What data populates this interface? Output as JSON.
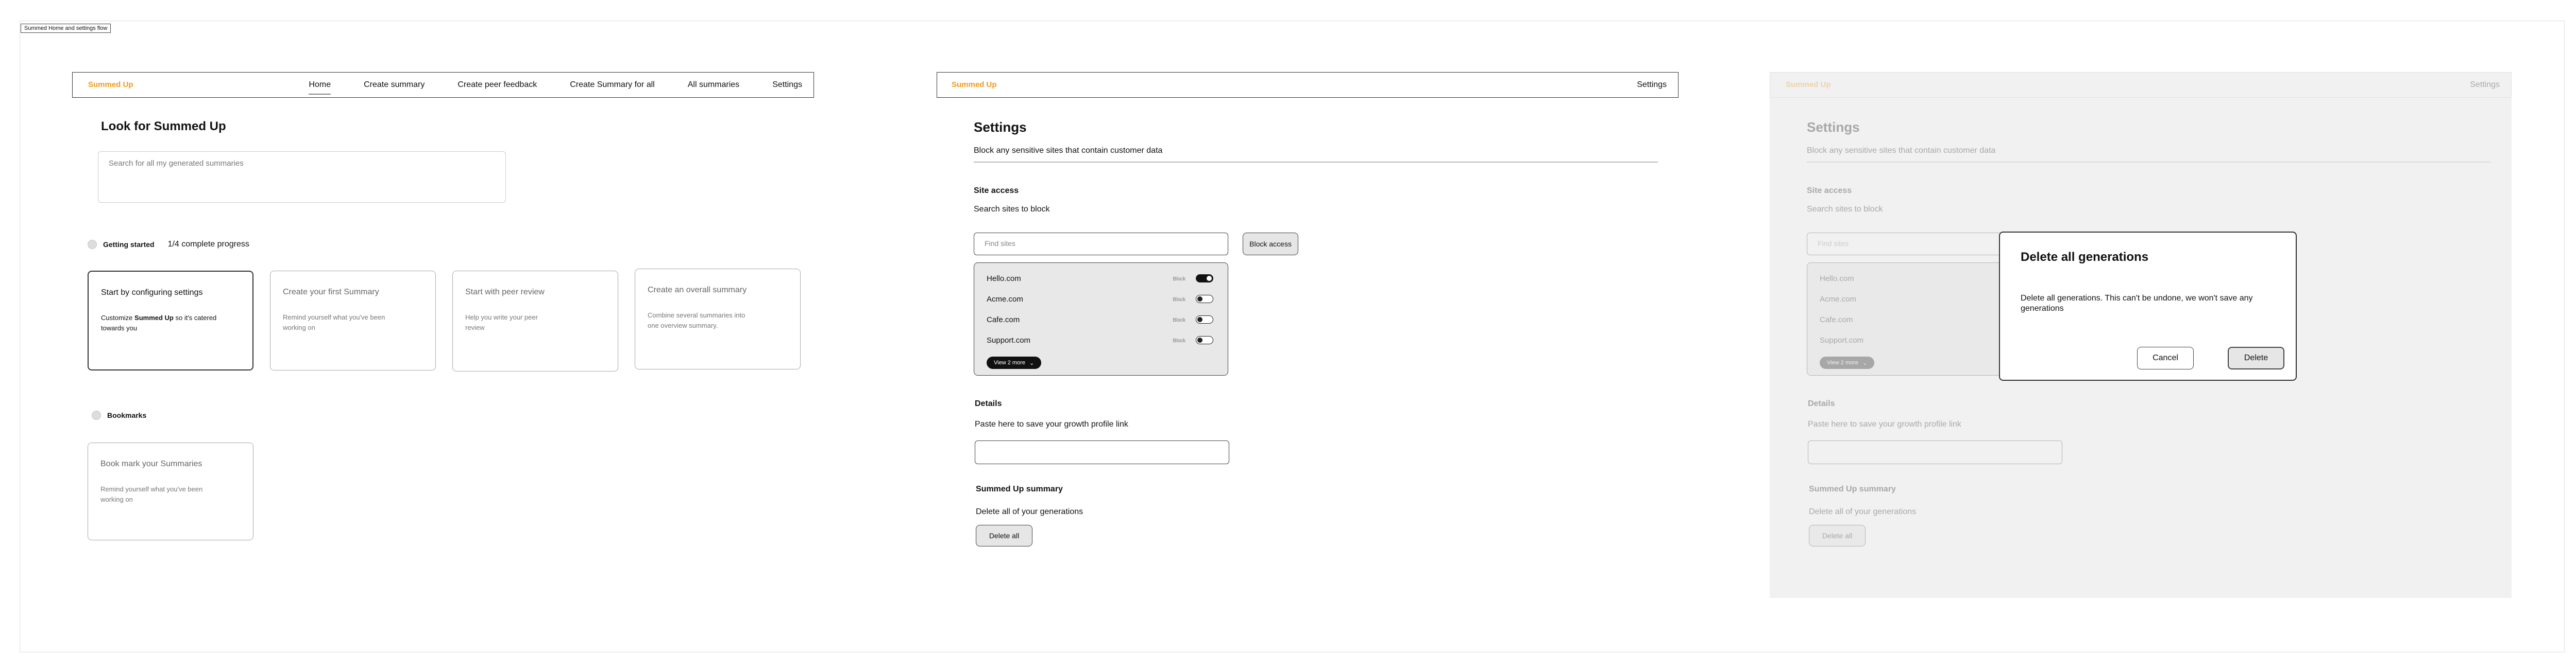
{
  "flow_label": "Summed Home and settings flow",
  "brand": "Summed Up",
  "home": {
    "nav": [
      "Home",
      "Create summary",
      "Create peer feedback",
      "Create Summary for all",
      "All summaries",
      "Settings"
    ],
    "title": "Look for Summed Up",
    "search_placeholder": "Search for all my generated summaries",
    "getting_started": "Getting started",
    "progress": "1/4 complete progress",
    "cards": [
      {
        "title": "Start by configuring settings",
        "desc_pre": "Customize ",
        "desc_bold": "Summed Up",
        "desc_post": " so it's catered towards you"
      },
      {
        "title": "Create your first Summary",
        "desc": "Remind yourself what you've been working on"
      },
      {
        "title": "Start with peer review",
        "desc": "Help you write your peer review"
      },
      {
        "title": "Create an overall summary",
        "desc": "Combine several summaries into one overview summary."
      }
    ],
    "bookmarks": "Bookmarks",
    "bookmark_card": {
      "title": "Book mark your Summaries",
      "desc": "Remind yourself what you've been working on"
    }
  },
  "settings": {
    "nav_item": "Settings",
    "title": "Settings",
    "subtitle": "Block any sensitive sites that contain customer data",
    "site_access": "Site access",
    "search_sites": "Search sites to block",
    "find_sites_placeholder": "Find sites",
    "block_access": "Block access",
    "block_label": "Block",
    "sites": [
      {
        "name": "Hello.com",
        "blocked": true
      },
      {
        "name": "Acme.com",
        "blocked": false
      },
      {
        "name": "Cafe.com",
        "blocked": false
      },
      {
        "name": "Support.com",
        "blocked": false
      }
    ],
    "view_more": "View 2 more",
    "details": "Details",
    "paste_text": "Paste here to save your growth profile link",
    "summary_heading": "Summed Up  summary",
    "delete_text": "Delete all of your generations",
    "delete_all": "Delete all"
  },
  "modal": {
    "title": "Delete all generations",
    "body": "Delete all generations. This can't be undone, we won't save any generations",
    "cancel": "Cancel",
    "delete": "Delete"
  },
  "colors": {
    "brand": "#f29a1a"
  }
}
